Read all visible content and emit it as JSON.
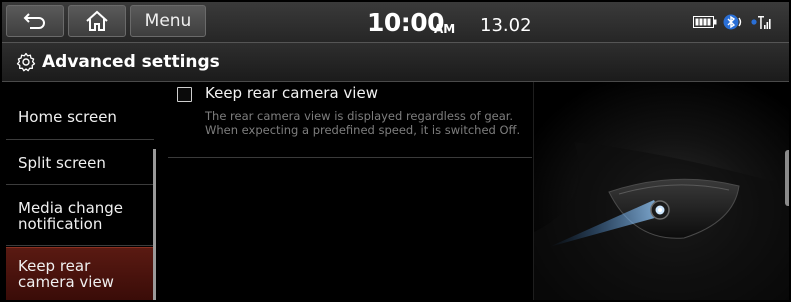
{
  "status_bar": {
    "back_icon": "back-arrow-icon",
    "home_icon": "home-icon",
    "menu_label": "Menu",
    "time": "10:00",
    "ampm": "AM",
    "date": "13.02",
    "icons": [
      "battery-icon",
      "bluetooth-audio-icon",
      "signal-icon"
    ]
  },
  "title_bar": {
    "icon": "gear-icon",
    "title": "Advanced settings"
  },
  "sidebar": {
    "items": [
      {
        "label": "Home screen",
        "selected": false
      },
      {
        "label": "Split screen",
        "selected": false
      },
      {
        "label": "Media change notification",
        "selected": false
      },
      {
        "label": "Keep rear camera view",
        "selected": true
      }
    ]
  },
  "content": {
    "option": {
      "label": "Keep rear camera view",
      "checked": false,
      "description": "The rear camera view is displayed regardless of gear. When expecting a predefined speed, it is switched Off."
    }
  },
  "colors": {
    "selected_bg": "#4a140e",
    "accent_glow": "#6fb0ff",
    "description_text": "#7e7e7e"
  }
}
